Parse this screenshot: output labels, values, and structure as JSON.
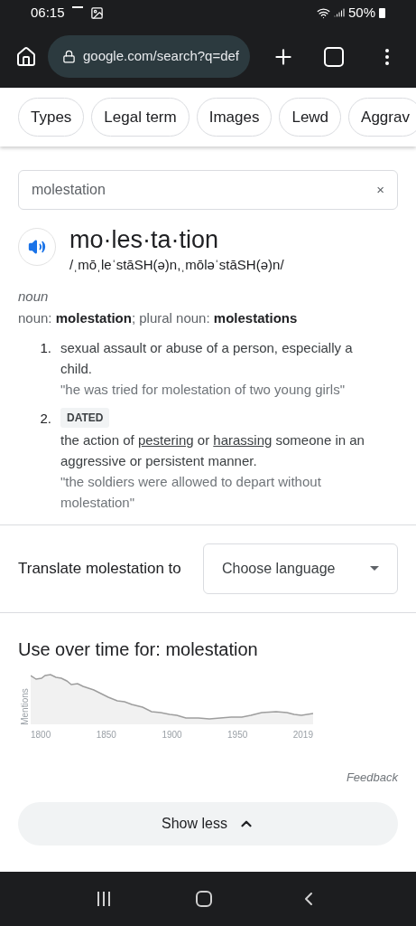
{
  "status_bar": {
    "time": "06:15",
    "battery": "50%"
  },
  "browser": {
    "url": "google.com/search?q=def"
  },
  "chips": [
    {
      "label": "Types"
    },
    {
      "label": "Legal term"
    },
    {
      "label": "Images"
    },
    {
      "label": "Lewd"
    },
    {
      "label": "Aggrav"
    }
  ],
  "search_field": {
    "value": "molestation",
    "clear": "×"
  },
  "entry": {
    "headword": "mo·les·ta·tion",
    "pronunciation": "/ˌmōˌleˈstāSH(ə)n,ˌmōləˈstāSH(ə)n/",
    "part_of_speech": "noun",
    "forms": "noun: **molestation**; plural noun: **molestations**",
    "senses": [
      {
        "number": "1.",
        "parts": [
          {
            "text": "sexual assault or abuse of a person, especially a child.",
            "link": false
          }
        ],
        "example": "\"he was tried for molestation of two young girls\""
      },
      {
        "number": "2.",
        "label": "DATED",
        "parts": [
          {
            "text": "the action of ",
            "link": false
          },
          {
            "text": "pestering",
            "link": true
          },
          {
            "text": " or ",
            "link": false
          },
          {
            "text": "harassing",
            "link": true
          },
          {
            "text": " someone in an aggressive or persistent manner.",
            "link": false
          }
        ],
        "example": "\"the soldiers were allowed to depart without molestation\""
      }
    ]
  },
  "translate": {
    "label": "Translate molestation to",
    "select_placeholder": "Choose language"
  },
  "usage": {
    "title": "Use over time for: molestation",
    "ylabel": "Mentions",
    "xticks": [
      "1800",
      "1850",
      "1900",
      "1950",
      "2019"
    ]
  },
  "feedback": "Feedback",
  "show_less": "Show less"
}
